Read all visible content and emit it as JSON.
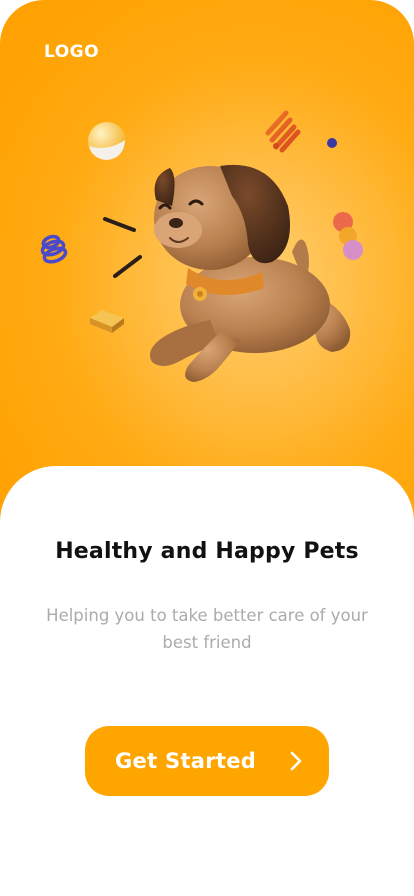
{
  "header": {
    "logo_text": "LOGO"
  },
  "hero": {
    "illustration": "puppy-3d-illustration",
    "accent_color": "#ffa500",
    "decorations": [
      "ball-icon",
      "spring-icon",
      "dot-icon",
      "stacked-balls-icon",
      "coil-icon",
      "dash-icon",
      "treat-icon"
    ]
  },
  "onboarding": {
    "title": "Healthy and Happy Pets",
    "subtitle": "Helping you to take better care of your best friend"
  },
  "cta": {
    "label": "Get Started",
    "icon": "chevron-right-icon",
    "color": "#ffa500"
  }
}
